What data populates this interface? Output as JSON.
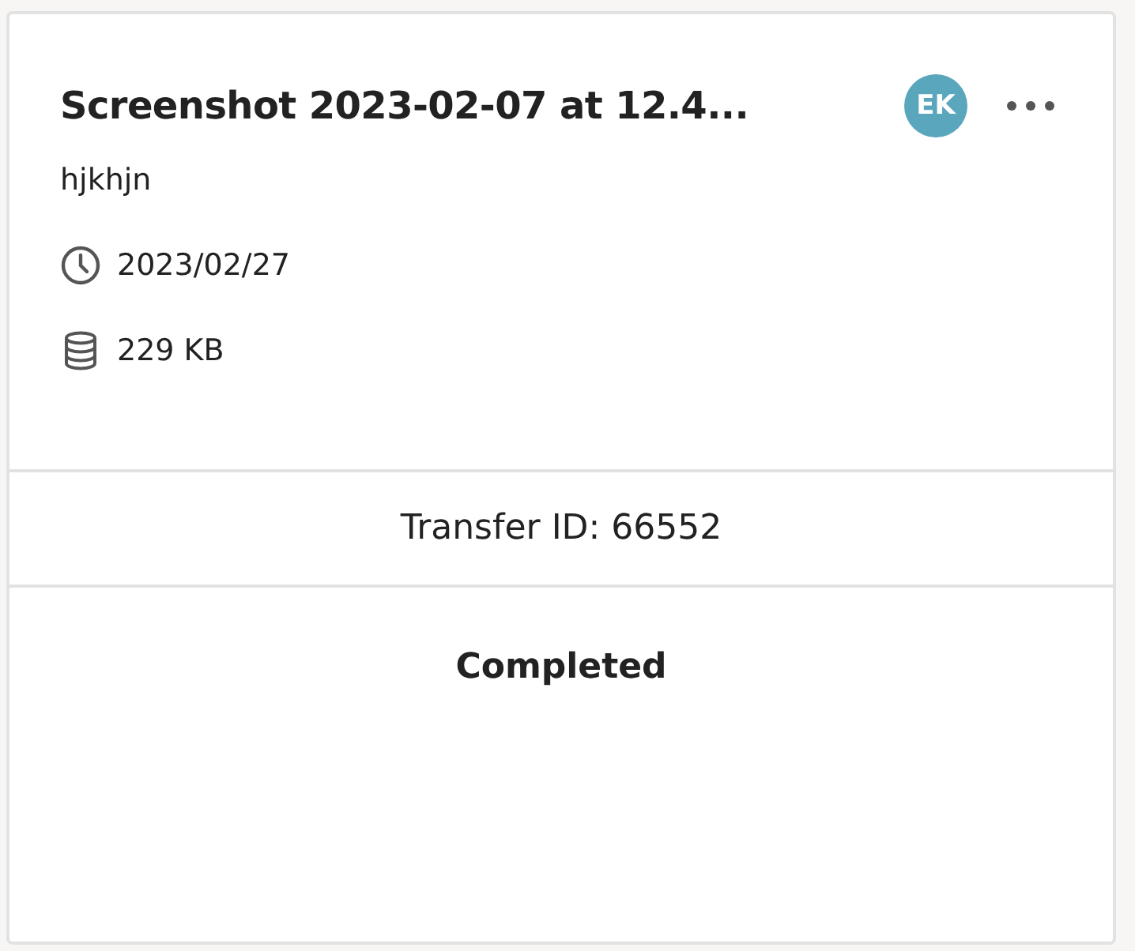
{
  "card": {
    "title": "Screenshot 2023-02-07 at 12.4...",
    "avatar": {
      "initials": "EK",
      "color": "#5aa6bd"
    },
    "description": "hjkhjn",
    "details": [
      {
        "kind": "date",
        "text": "2023/02/27"
      },
      {
        "kind": "size",
        "text": "229 KB"
      }
    ],
    "transfer_id": "Transfer ID: 66552",
    "status": "Completed"
  }
}
